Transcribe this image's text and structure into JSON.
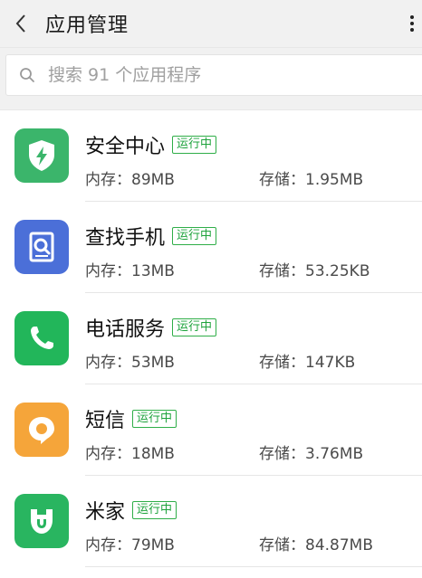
{
  "header": {
    "title": "应用管理"
  },
  "search": {
    "placeholder": "搜索 91 个应用程序"
  },
  "labels": {
    "memory_prefix": "内存：",
    "storage_prefix": "存储："
  },
  "apps": [
    {
      "name": "安全中心",
      "status": "运行中",
      "memory": "内存：89MB",
      "storage": "存储：1.95MB",
      "icon": "shield-bolt-icon",
      "color": "#3bb56b"
    },
    {
      "name": "查找手机",
      "status": "运行中",
      "memory": "内存：13MB",
      "storage": "存储：53.25KB",
      "icon": "search-phone-icon",
      "color": "#4b6fd8"
    },
    {
      "name": "电话服务",
      "status": "运行中",
      "memory": "内存：53MB",
      "storage": "存储：147KB",
      "icon": "phone-icon",
      "color": "#22b65a"
    },
    {
      "name": "短信",
      "status": "运行中",
      "memory": "内存：18MB",
      "storage": "存储：3.76MB",
      "icon": "message-icon",
      "color": "#f5a53a"
    },
    {
      "name": "米家",
      "status": "运行中",
      "memory": "内存：79MB",
      "storage": "存储：84.87MB",
      "icon": "mijia-icon",
      "color": "#29b560"
    }
  ]
}
